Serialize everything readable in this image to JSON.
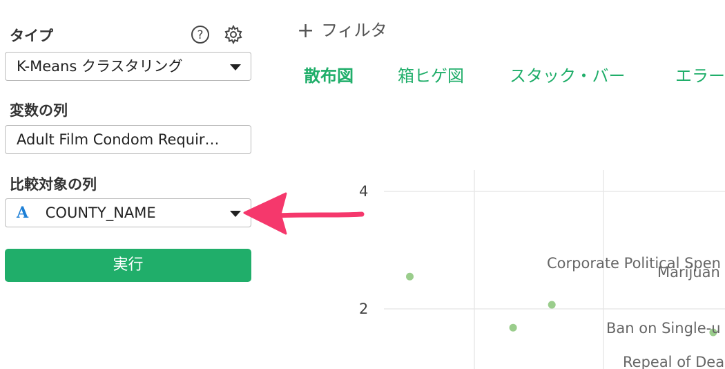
{
  "sidebar": {
    "type_label": "タイプ",
    "type_value": "K-Means クラスタリング",
    "variables_label": "変数の列",
    "variables_value": "Adult Film Condom Requir…",
    "compare_label": "比較対象の列",
    "compare_type_glyph": "A",
    "compare_value": "COUNTY_NAME",
    "run_label": "実行",
    "icons": [
      "help-icon",
      "gear-icon"
    ]
  },
  "toolbar": {
    "filter_plus": "+",
    "filter_label": "フィルタ"
  },
  "tabs": [
    {
      "label": "散布図",
      "active": true
    },
    {
      "label": "箱ヒゲ図",
      "active": false
    },
    {
      "label": "スタック・バー",
      "active": false
    },
    {
      "label": "エラー",
      "active": false
    }
  ],
  "colors": {
    "accent": "#20ae6a",
    "point": "#9acd8c",
    "arrow": "#f5386c"
  },
  "chart_data": {
    "type": "scatter",
    "y_ticks": [
      "4",
      "2"
    ],
    "points": [
      {
        "x": 0.5,
        "y": 2.55
      },
      {
        "x": 1.6,
        "y": 2.07
      },
      {
        "x": 1.3,
        "y": 1.68
      },
      {
        "x": 2.85,
        "y": 1.6
      }
    ],
    "labels": [
      "Corporate Political Spen",
      "Marijuan",
      "Ban on Single-u",
      "Repeal of Dea"
    ]
  }
}
